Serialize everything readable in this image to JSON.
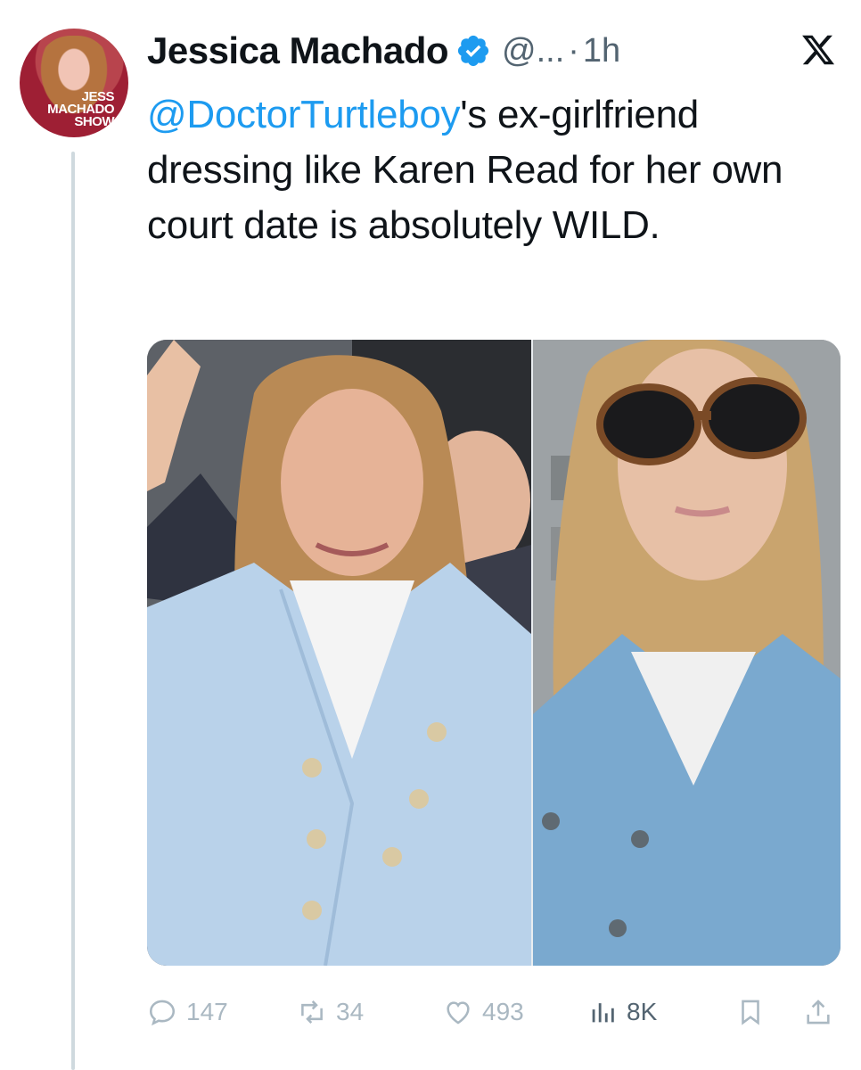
{
  "author": {
    "name": "Jessica Machado",
    "handle": "@...",
    "separator": "·",
    "time": "1h",
    "avatar_text": [
      "JESS",
      "MACHADO",
      "SHOW"
    ]
  },
  "tweet": {
    "mention": "@DoctorTurtleboy",
    "text_after_mention": "'s ex-girlfriend dressing like Karen Read for her own court date is absolutely WILD."
  },
  "media": {
    "count": 2,
    "left_photo": "woman in light blue double-breasted blazer waving, man smiling behind",
    "right_photo": "woman with tortoiseshell sunglasses in light blue blazer selfie"
  },
  "actions": {
    "replies": "147",
    "reposts": "34",
    "likes": "493",
    "views": "8K"
  },
  "icons": {
    "verified": "verified-badge-icon",
    "x": "x-logo-icon",
    "reply": "reply-icon",
    "repost": "repost-icon",
    "like": "heart-icon",
    "views": "views-icon",
    "bookmark": "bookmark-icon",
    "share": "share-icon"
  },
  "colors": {
    "link": "#1d9bf0",
    "verified": "#1d9bf0",
    "muted": "#536471",
    "faded_icon": "#aab8c2"
  }
}
